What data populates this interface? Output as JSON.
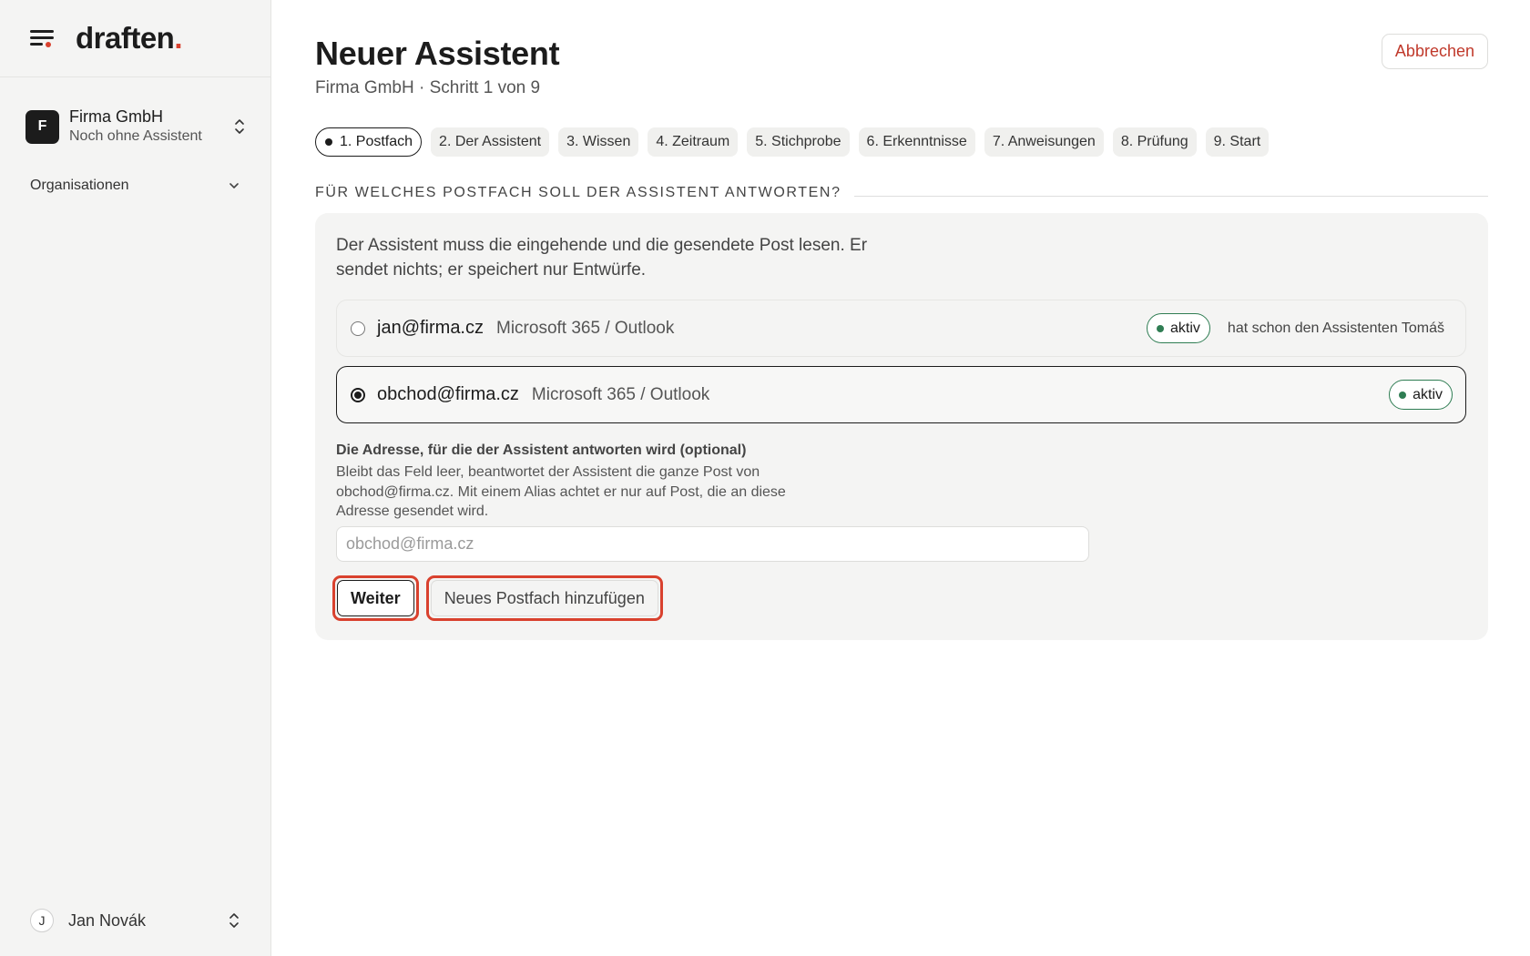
{
  "brand": {
    "name": "draften",
    "dot": "."
  },
  "sidebar": {
    "org": {
      "avatar_letter": "F",
      "name": "Firma GmbH",
      "subtitle": "Noch ohne Assistent"
    },
    "section_label": "Organisationen",
    "user": {
      "avatar_letter": "J",
      "name": "Jan Novák"
    }
  },
  "header": {
    "title": "Neuer Assistent",
    "subtitle": "Firma GmbH · Schritt 1 von 9",
    "cancel_label": "Abbrechen"
  },
  "steps": [
    {
      "label": "1. Postfach",
      "active": true
    },
    {
      "label": "2. Der Assistent"
    },
    {
      "label": "3. Wissen"
    },
    {
      "label": "4. Zeitraum"
    },
    {
      "label": "5. Stichprobe"
    },
    {
      "label": "6. Erkenntnisse"
    },
    {
      "label": "7. Anweisungen"
    },
    {
      "label": "8. Prüfung"
    },
    {
      "label": "9. Start"
    }
  ],
  "section_title": "FÜR WELCHES POSTFACH SOLL DER ASSISTENT ANTWORTEN?",
  "card": {
    "intro": "Der Assistent muss die eingehende und die gesendete Post lesen. Er sendet nichts; er speichert nur Entwürfe.",
    "mailboxes": [
      {
        "address": "jan@firma.cz",
        "provider": "Microsoft 365 / Outlook",
        "status": "aktiv",
        "note": "hat schon den Assistenten Tomáš",
        "selected": false
      },
      {
        "address": "obchod@firma.cz",
        "provider": "Microsoft 365 / Outlook",
        "status": "aktiv",
        "note": "",
        "selected": true
      }
    ],
    "alias": {
      "label": "Die Adresse, für die der Assistent antworten wird (optional)",
      "help": "Bleibt das Feld leer, beantwortet der Assistent die ganze Post von obchod@firma.cz. Mit einem Alias achtet er nur auf Post, die an diese Adresse gesendet wird.",
      "value": "",
      "placeholder": "obchod@firma.cz"
    },
    "buttons": {
      "next": "Weiter",
      "add_mailbox": "Neues Postfach hinzufügen"
    }
  },
  "colors": {
    "accent": "#d9412e",
    "status_green": "#2f7d53",
    "sidebar_bg": "#f4f4f3"
  }
}
